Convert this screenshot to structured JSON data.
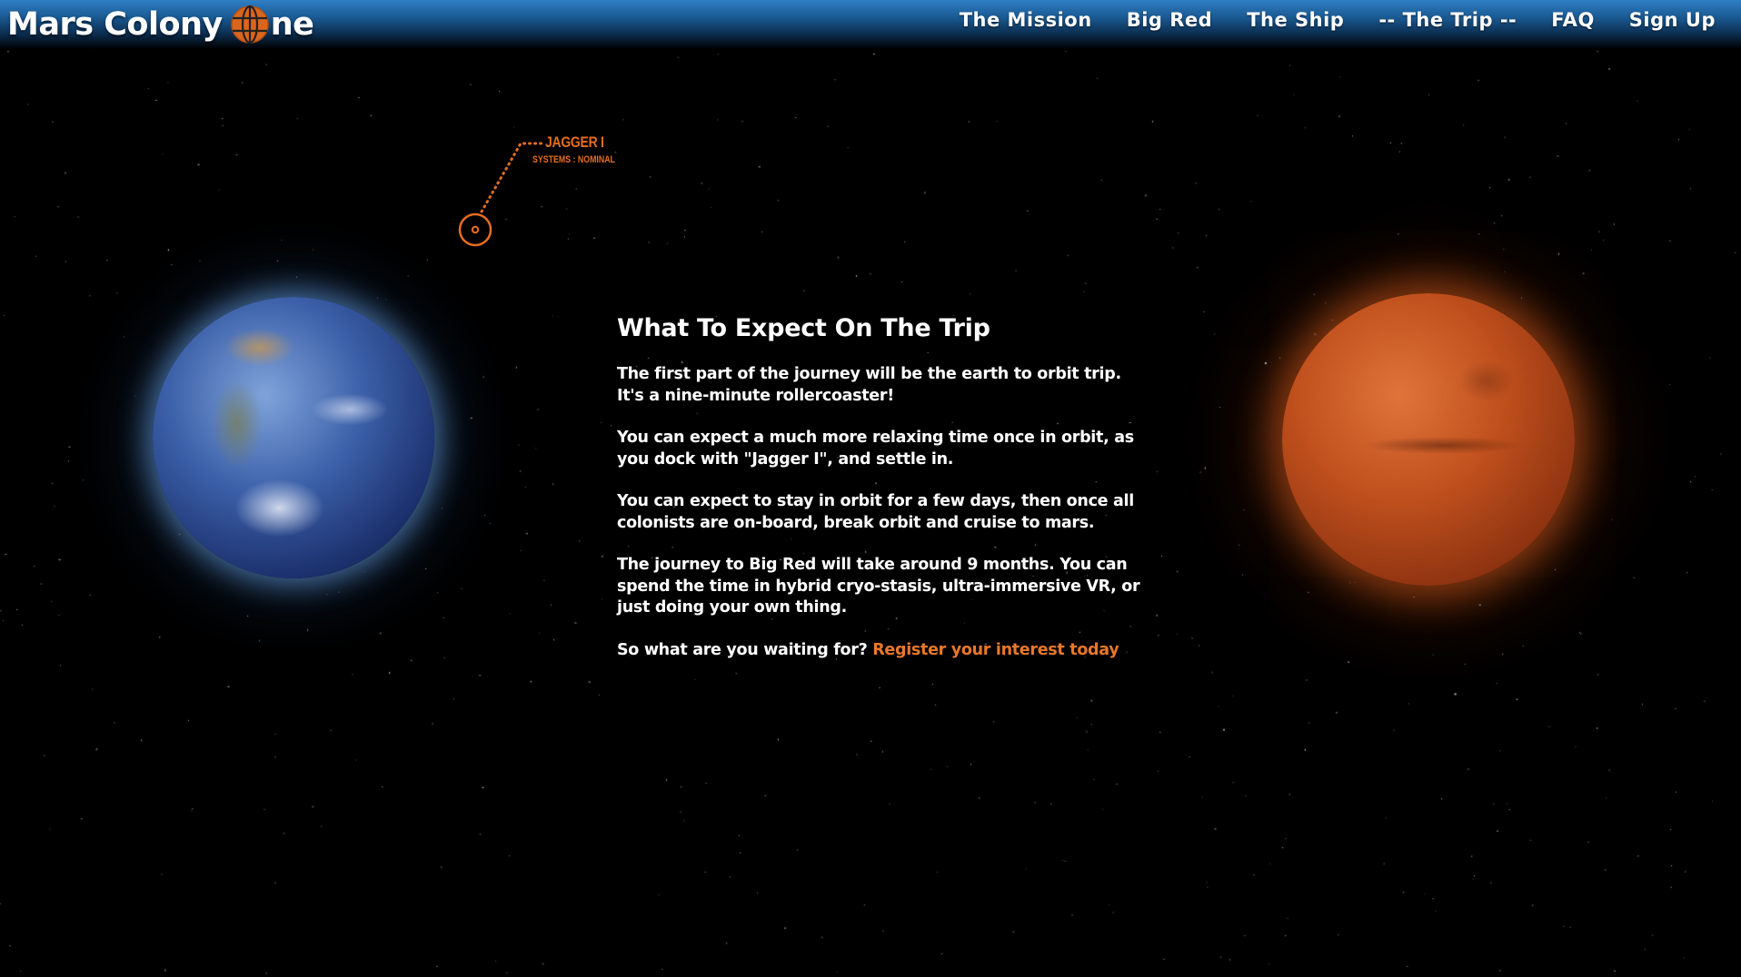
{
  "brand": {
    "prefix": "Mars Colony",
    "suffix": "ne"
  },
  "nav": {
    "items": [
      "The Mission",
      "Big Red",
      "The Ship",
      "-- The Trip --",
      "FAQ",
      "Sign Up"
    ]
  },
  "ship": {
    "name": "JAGGER I",
    "status": "SYSTEMS : NOMINAL"
  },
  "content": {
    "heading": "What To Expect On The Trip",
    "paragraphs": [
      "The first part of the journey will be the earth to orbit trip. It's a nine-minute rollercoaster!",
      "You can expect a much more relaxing time once in orbit, as you dock with \"Jagger I\", and settle in.",
      "You can expect to stay in orbit for a few days, then once all colonists are on-board, break orbit and cruise to mars.",
      "The journey to Big Red will take around 9 months. You can spend the time in hybrid cryo-stasis, ultra-immersive VR, or just doing your own thing."
    ],
    "cta_prefix": "So what are you waiting for?",
    "cta_link": "Register your interest today"
  },
  "colors": {
    "accent": "#e8782a",
    "nav_top": "#2f7fc4",
    "background": "#000000"
  },
  "icons": {
    "logo_letter": "globe-icon",
    "ship_marker": "target-icon"
  }
}
